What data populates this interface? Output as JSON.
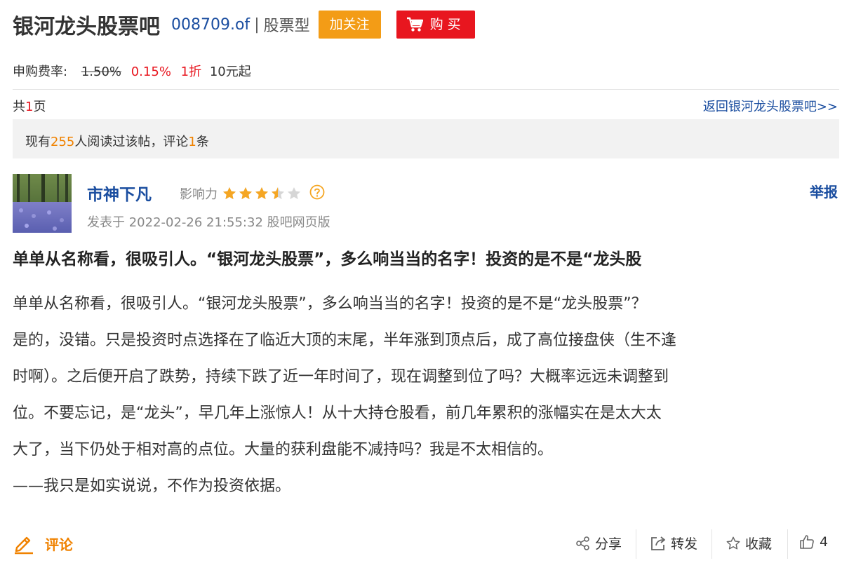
{
  "header": {
    "bar_title": "银河龙头股票吧",
    "fund_code": "008709.of",
    "separator": "|",
    "fund_type": "股票型",
    "follow_label": "加关注",
    "buy_label": "购 买"
  },
  "fee": {
    "label": "申购费率:",
    "original_rate": "1.50%",
    "current_rate": "0.15%",
    "discount": "1折",
    "minimum": "10元起"
  },
  "pager": {
    "prefix": "共",
    "total_pages": "1",
    "suffix": "页",
    "back_link": "返回银河龙头股票吧>>"
  },
  "stats": {
    "prefix": "现有",
    "readers": "255",
    "middle": "人阅读过该帖，评论",
    "comments": "1",
    "suffix": "条"
  },
  "post": {
    "author": "市神下凡",
    "influence_label": "影响力",
    "influence_stars": 3.5,
    "influence_max": 5,
    "report_label": "举报",
    "meta": "发表于 2022-02-26 21:55:32 股吧网页版",
    "title": "单单从名称看，很吸引人。“银河龙头股票”，多么响当当的名字！投资的是不是“龙头股",
    "body": [
      "单单从名称看，很吸引人。“银河龙头股票”，多么响当当的名字！投资的是不是“龙头股票”？",
      "是的，没错。只是投资时点选择在了临近大顶的末尾，半年涨到顶点后，成了高位接盘侠（生不逢",
      "时啊）。之后便开启了跌势，持续下跌了近一年时间了，现在调整到位了吗？大概率远远未调整到",
      "位。不要忘记，是“龙头”，早几年上涨惊人！从十大持仓股看，前几年累积的涨幅实在是太大太",
      "大了，当下仍处于相对高的点位。大量的获利盘能不减持吗？我是不太相信的。",
      "——我只是如实说说，不作为投资依据。"
    ]
  },
  "actions": {
    "comment_label": "评论",
    "share_label": "分享",
    "repost_label": "转发",
    "favorite_label": "收藏",
    "like_count": "4"
  },
  "colors": {
    "link_blue": "#1b4ea0",
    "accent_orange": "#f08200",
    "follow_orange": "#f39c16",
    "buy_red": "#e8161f",
    "star_gold": "#f5a623"
  },
  "icons": {
    "cart": "cart-icon",
    "pencil": "pencil-icon",
    "share": "share-icon",
    "repost": "repost-icon",
    "favorite": "star-outline-icon",
    "like": "thumbs-up-icon",
    "help": "help-circle-icon"
  }
}
